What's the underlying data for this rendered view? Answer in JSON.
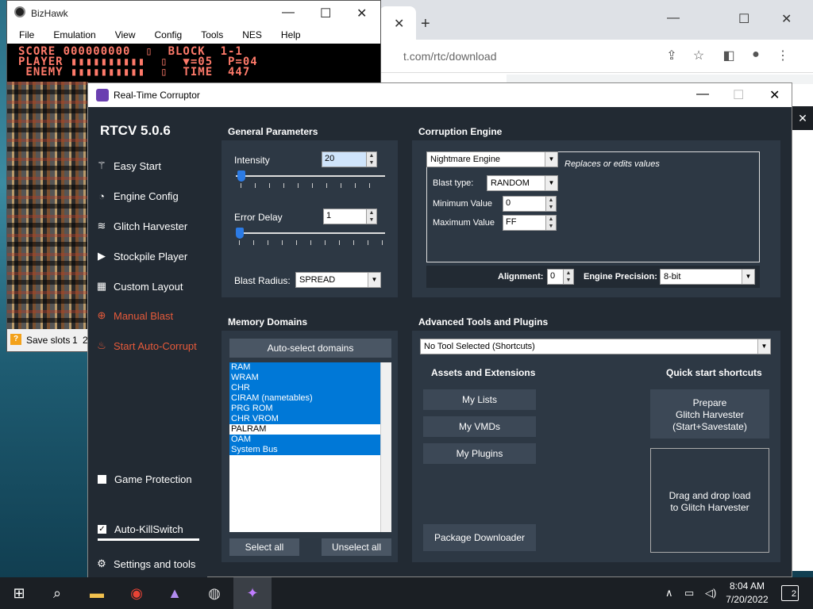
{
  "chrome": {
    "url": "t.com/rtc/download",
    "tab_close": "✕",
    "new_tab": "+",
    "minimize": "—",
    "maximize": "☐",
    "close": "✕"
  },
  "bizhawk": {
    "title": "BizHawk",
    "menu": [
      "File",
      "Emulation",
      "View",
      "Config",
      "Tools",
      "NES",
      "Help"
    ],
    "hud_line1": "SCORE 000000000  ▯  BLOCK  1-1",
    "hud_line2": "PLAYER ▮▮▮▮▮▮▮▮▮▮  ▯  ▼=05  P=04",
    "hud_line3": " ENEMY ▮▮▮▮▮▮▮▮▮▮  ▯  TIME  447",
    "status": "Save slots",
    "slot1": "1",
    "slot2": "2"
  },
  "rtc": {
    "title": "Real-Time Corruptor",
    "version": "RTCV 5.0.6",
    "sidebar": {
      "items": [
        {
          "label": "Easy Start",
          "icon": "wand-icon"
        },
        {
          "label": "Engine Config",
          "icon": "gauge-icon"
        },
        {
          "label": "Glitch Harvester",
          "icon": "layers-icon"
        },
        {
          "label": "Stockpile Player",
          "icon": "play-icon"
        },
        {
          "label": "Custom Layout",
          "icon": "grid-icon"
        },
        {
          "label": "Manual Blast",
          "icon": "crosshair-icon"
        },
        {
          "label": "Start Auto-Corrupt",
          "icon": "fire-icon"
        }
      ],
      "game_protection": "Game Protection",
      "auto_killswitch": "Auto-KillSwitch",
      "settings": "Settings and tools"
    },
    "general": {
      "header": "General Parameters",
      "intensity_label": "Intensity",
      "intensity_value": "20",
      "error_delay_label": "Error Delay",
      "error_delay_value": "1",
      "blast_radius_label": "Blast Radius:",
      "blast_radius_value": "SPREAD"
    },
    "engine": {
      "header": "Corruption Engine",
      "engine_value": "Nightmare Engine",
      "description": "Replaces or edits values",
      "blast_type_label": "Blast type:",
      "blast_type_value": "RANDOM",
      "min_label": "Minimum Value",
      "min_value": "0",
      "max_label": "Maximum Value",
      "max_value": "FF",
      "alignment_label": "Alignment:",
      "alignment_value": "0",
      "precision_label": "Engine Precision:",
      "precision_value": "8-bit"
    },
    "memory": {
      "header": "Memory Domains",
      "auto_select": "Auto-select domains",
      "domains": [
        "RAM",
        "WRAM",
        "CHR",
        "CIRAM (nametables)",
        "PRG ROM",
        "CHR VROM",
        "PALRAM",
        "OAM",
        "System Bus"
      ],
      "select_all": "Select all",
      "unselect_all": "Unselect all"
    },
    "advanced": {
      "header": "Advanced Tools and Plugins",
      "tool_select": "No Tool Selected (Shortcuts)",
      "assets_header": "Assets and Extensions",
      "quick_header": "Quick start shortcuts",
      "my_lists": "My Lists",
      "my_vmds": "My VMDs",
      "my_plugins": "My Plugins",
      "package_downloader": "Package Downloader",
      "prepare_l1": "Prepare",
      "prepare_l2": "Glitch Harvester",
      "prepare_l3": "(Start+Savestate)",
      "drag_l1": "Drag and drop load",
      "drag_l2": "to Glitch Harvester"
    }
  },
  "taskbar": {
    "time": "8:04 AM",
    "date": "7/20/2022",
    "notifications": "2"
  }
}
